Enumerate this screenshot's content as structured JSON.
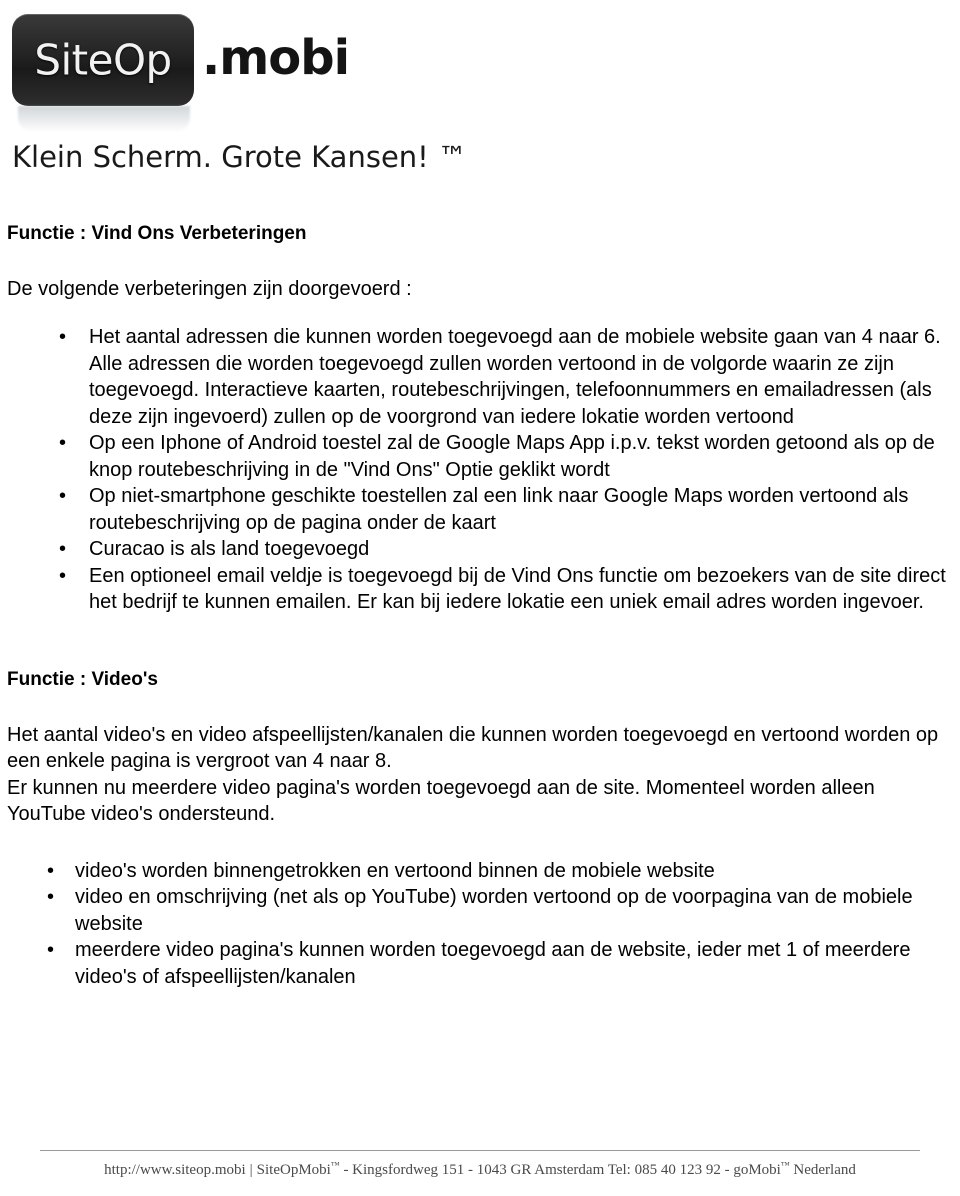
{
  "brand": {
    "logo_badge_text": "SiteOp",
    "logo_tld_text": ".mobi",
    "tagline": "Klein Scherm. Grote Kansen! ™"
  },
  "sections": [
    {
      "heading": "Functie : Vind Ons Verbeteringen",
      "intro": "De volgende verbeteringen zijn doorgevoerd :",
      "bullets": [
        "Het aantal adressen die kunnen worden toegevoegd aan de mobiele website gaan van 4 naar 6. Alle adressen die worden toegevoegd zullen worden vertoond in de volgorde waarin ze zijn toegevoegd. Interactieve kaarten, routebeschrijvingen, telefoonnummers en emailadressen (als deze zijn ingevoerd) zullen op de voorgrond van iedere lokatie worden vertoond",
        "Op een Iphone of Android toestel zal de Google Maps App i.p.v. tekst worden getoond als op de knop routebeschrijving in de \"Vind Ons\" Optie geklikt wordt",
        "Op niet-smartphone geschikte toestellen zal een link naar Google Maps worden vertoond als routebeschrijving op de pagina onder de kaart",
        "Curacao is als land toegevoegd",
        "Een optioneel email veldje is toegevoegd bij de Vind Ons functie om bezoekers van de site direct het bedrijf te kunnen emailen. Er kan bij iedere lokatie een uniek email adres worden ingevoer."
      ]
    },
    {
      "heading": "Functie : Video's",
      "paragraph_1": "Het aantal video's en video afspeellijsten/kanalen die kunnen worden toegevoegd en vertoond worden op een enkele pagina is vergroot van 4 naar 8.",
      "paragraph_2": "Er kunnen nu meerdere video pagina's worden toegevoegd aan de site. Momenteel worden alleen YouTube video's ondersteund.",
      "bullets": [
        "video's worden binnengetrokken en vertoond binnen de mobiele website",
        "video en omschrijving (net als op YouTube) worden vertoond op de voorpagina van de mobiele website",
        "meerdere video pagina's kunnen worden toegevoegd aan de website, ieder met 1 of meerdere video's of afspeellijsten/kanalen"
      ]
    }
  ],
  "footer": {
    "url": "http://www.siteop.mobi",
    "separator": "|",
    "company": "SiteOpMobi",
    "company_tm": "™",
    "address": "- Kingsfordweg 151 - 1043 GR Amsterdam Tel: 085 40 123 92 - goMobi",
    "address_tm": "™",
    "country": "Nederland"
  },
  "colors": {
    "text": "#000000",
    "logo_badge_bg": "#232323",
    "footer_text": "#4a4a4a",
    "footer_rule": "#9a9a9a"
  },
  "bullet_glyph": "•"
}
